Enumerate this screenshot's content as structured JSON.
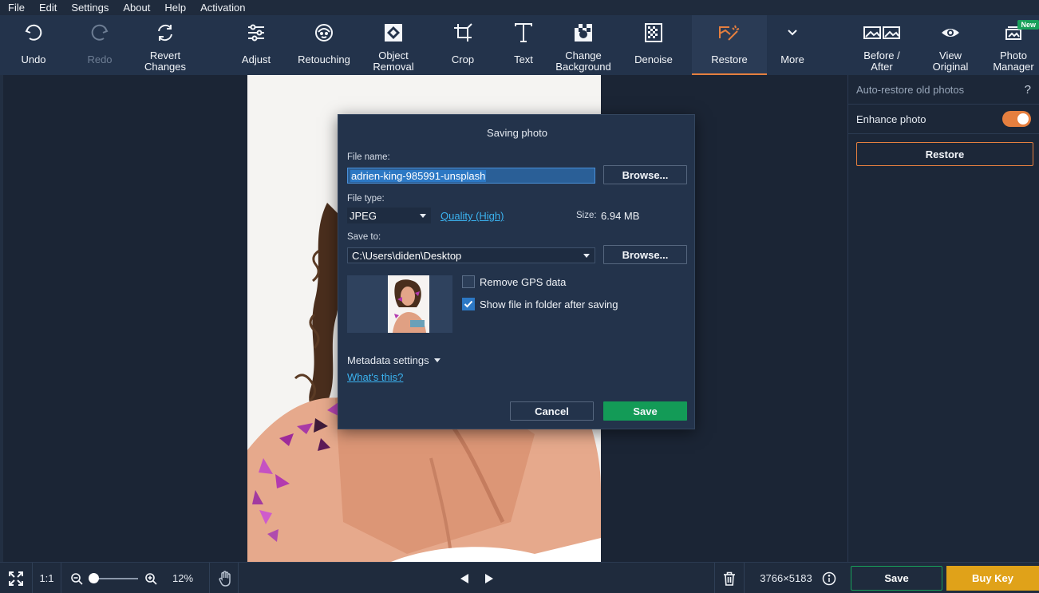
{
  "menu": [
    "File",
    "Edit",
    "Settings",
    "About",
    "Help",
    "Activation"
  ],
  "toolbar": {
    "undo": "Undo",
    "redo": "Redo",
    "revert_1": "Revert",
    "revert_2": "Changes",
    "adjust": "Adjust",
    "retouching": "Retouching",
    "object_removal_1": "Object",
    "object_removal_2": "Removal",
    "crop": "Crop",
    "text": "Text",
    "change_bg_1": "Change",
    "change_bg_2": "Background",
    "denoise": "Denoise",
    "restore": "Restore",
    "more": "More",
    "before_after_1": "Before /",
    "before_after_2": "After",
    "view_original_1": "View",
    "view_original_2": "Original",
    "photo_manager_1": "Photo",
    "photo_manager_2": "Manager",
    "new_badge": "New",
    "active_tool": "Restore"
  },
  "right_panel": {
    "header": "Auto-restore old photos",
    "help": "?",
    "enhance_label": "Enhance photo",
    "enhance_on": true,
    "restore_button": "Restore"
  },
  "dialog": {
    "title": "Saving photo",
    "file_name_label": "File name:",
    "file_name_value": "adrien-king-985991-unsplash",
    "browse_1": "Browse...",
    "file_type_label": "File type:",
    "file_type_value": "JPEG",
    "quality_link": "Quality (High)",
    "size_label": "Size:",
    "size_value": "6.94 MB",
    "save_to_label": "Save to:",
    "save_to_value": "C:\\Users\\diden\\Desktop",
    "browse_2": "Browse...",
    "remove_gps": "Remove GPS data",
    "remove_gps_checked": false,
    "show_in_folder": "Show file in folder after saving",
    "show_in_folder_checked": true,
    "metadata_settings": "Metadata settings",
    "whats_this": "What's this?",
    "cancel": "Cancel",
    "save": "Save"
  },
  "bottom": {
    "one_to_one": "1:1",
    "zoom": "12%",
    "zoom_level": 0.12,
    "dimensions": "3766×5183",
    "save": "Save",
    "buy_key": "Buy Key"
  },
  "colors": {
    "accent_orange": "#e57f3f",
    "save_green": "#139b57",
    "buy_gold": "#e0a219",
    "link_blue": "#3bb3f0"
  }
}
